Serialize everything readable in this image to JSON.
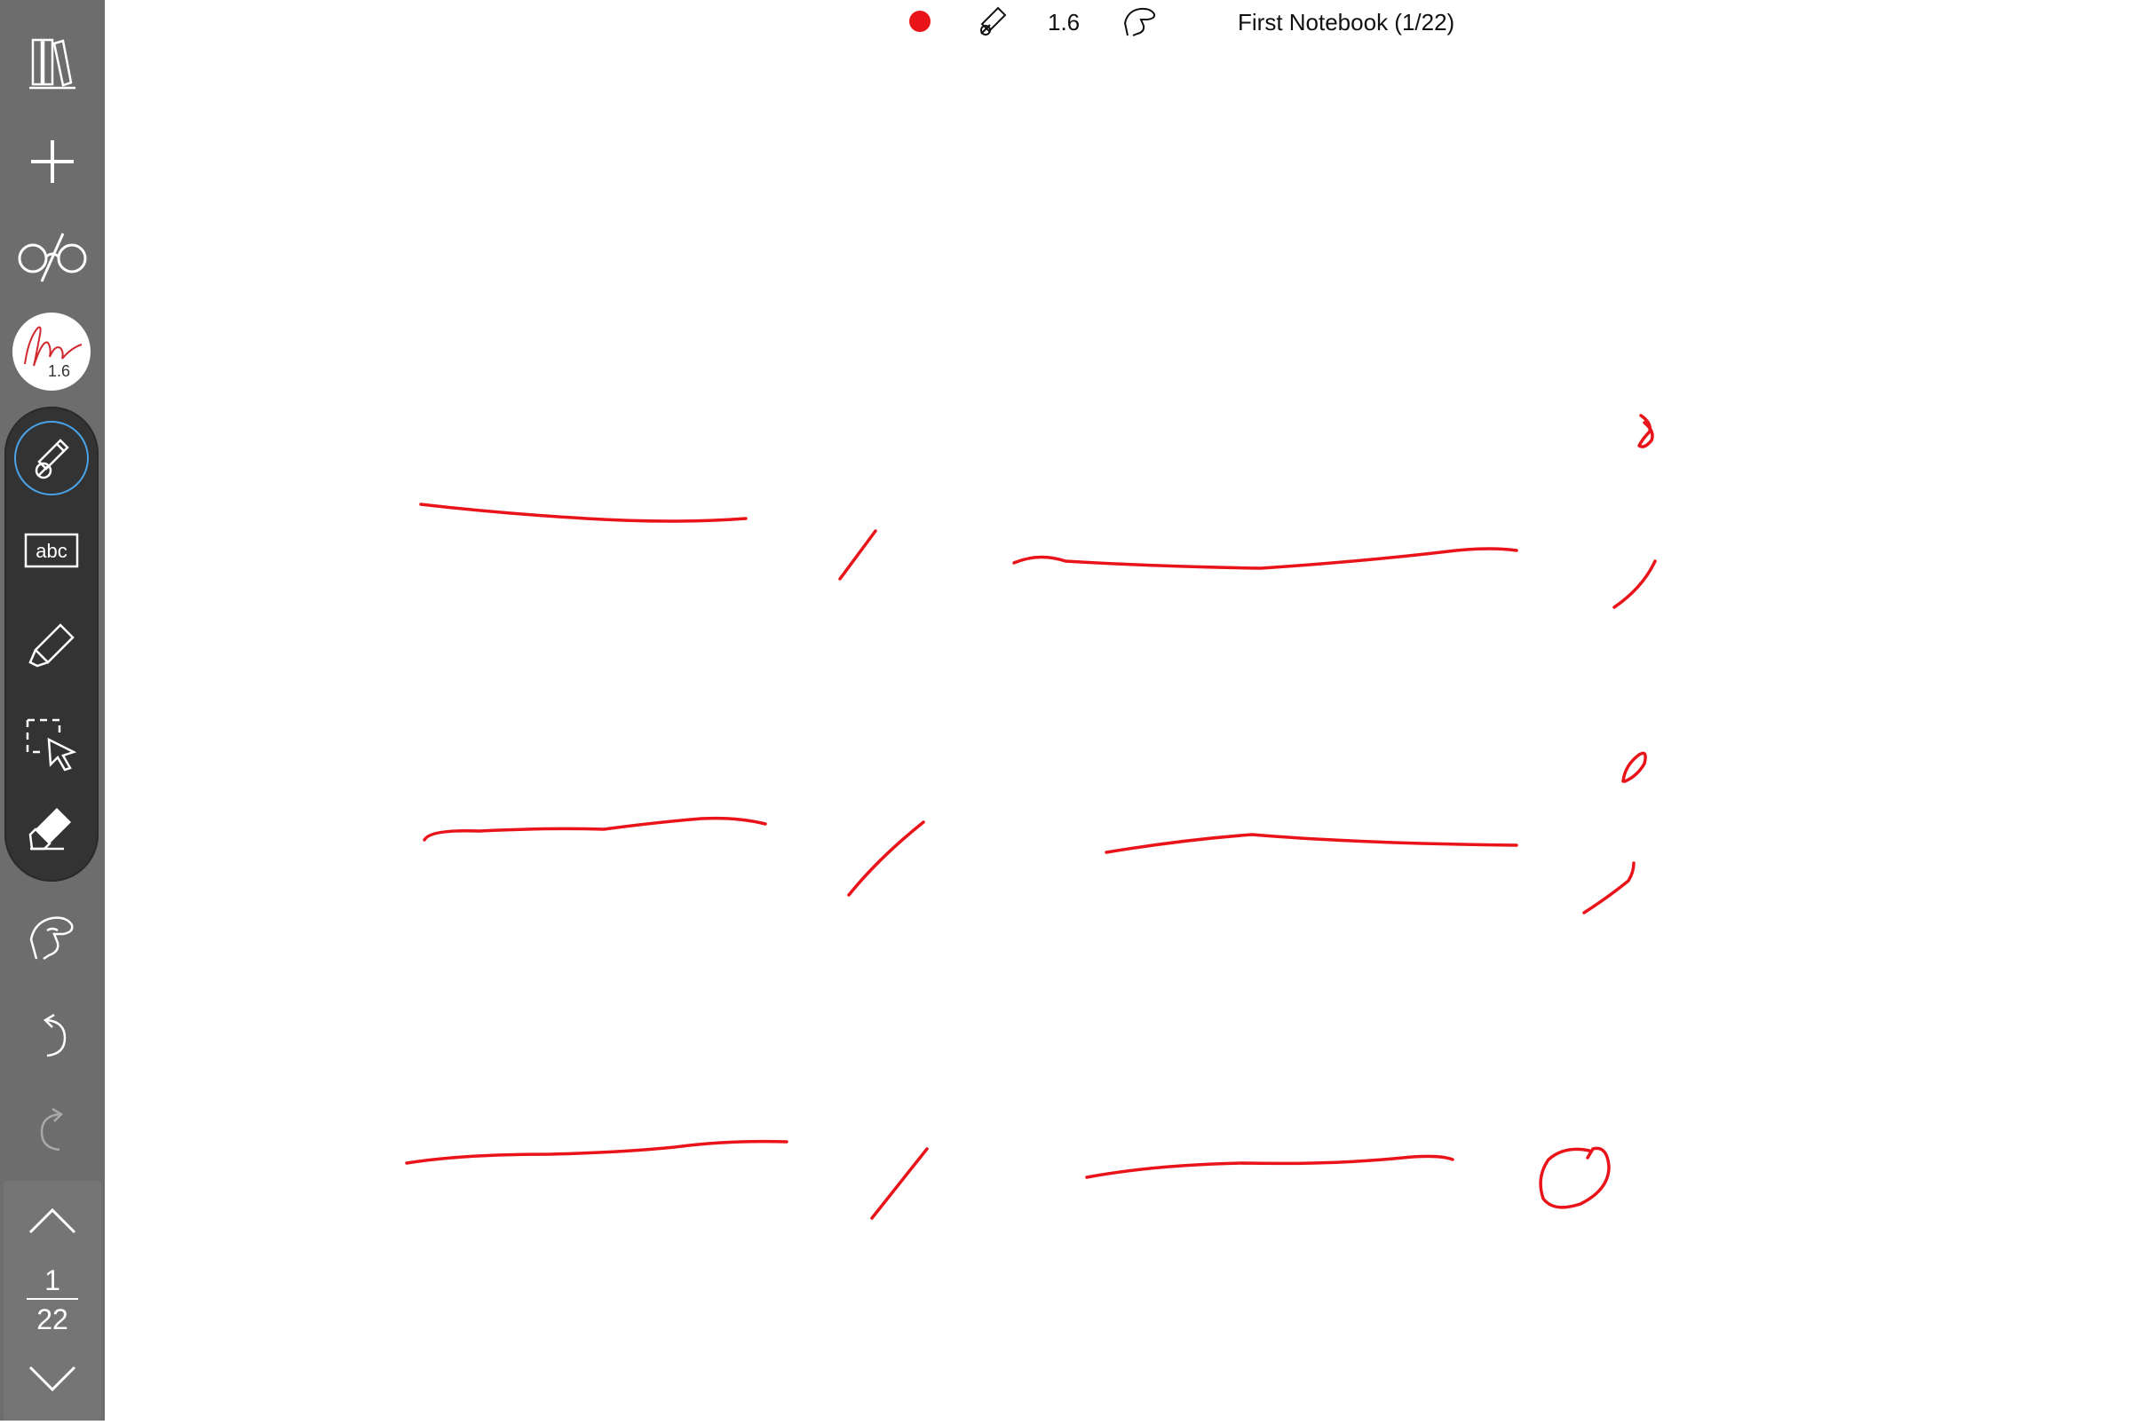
{
  "toolbar": {
    "pen_color": "#e8141a",
    "pen_size": "1.6",
    "notebook_title": "First Notebook (1/22)"
  },
  "sidebar": {
    "pen_badge_size": "1.6",
    "text_tool_label": "abc",
    "tools": [
      "library-icon",
      "add-page-icon",
      "glasses-icon",
      "pen-preview",
      "pen-icon",
      "text-icon",
      "highlighter-icon",
      "selection-icon",
      "eraser-icon",
      "hand-icon",
      "undo-icon",
      "redo-icon"
    ],
    "active_tool": "pen"
  },
  "pager": {
    "current": "1",
    "total": "22"
  },
  "canvas": {
    "ink_color": "#e8141a",
    "stroke_count": 17
  }
}
